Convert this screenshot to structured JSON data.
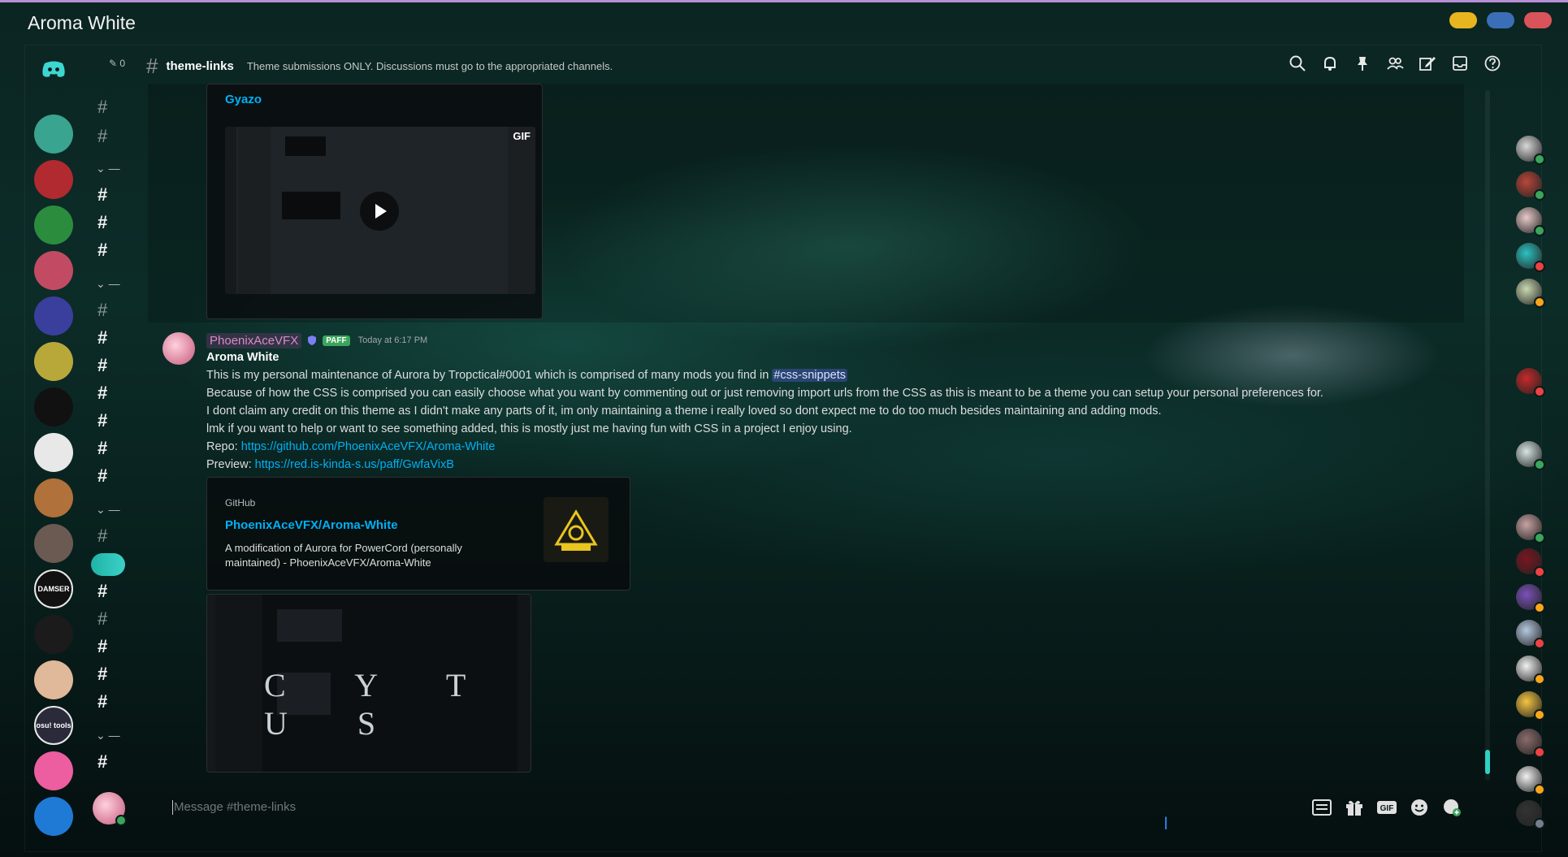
{
  "window": {
    "title": "Aroma White",
    "controls": [
      {
        "name": "minimize",
        "color": "#e6b51f"
      },
      {
        "name": "maximize",
        "color": "#3a6fb8"
      },
      {
        "name": "close",
        "color": "#d9545a"
      }
    ]
  },
  "channel_header": {
    "name": "theme-links",
    "topic": "Theme submissions ONLY. Discussions must go to the appropriated channels.",
    "mention_count": "0",
    "icons": [
      "search-icon",
      "bell-icon",
      "pin-icon",
      "members-icon",
      "edit-icon",
      "inbox-icon",
      "help-icon"
    ]
  },
  "previous_embed": {
    "provider": "Gyazo",
    "media_label": "GIF"
  },
  "message": {
    "author": "PhoenixAceVFX",
    "badge": "PAFF",
    "timestamp": "Today at 6:17 PM",
    "title": "Aroma White",
    "line1_prefix": "This is my personal maintenance of Aurora by Tropctical#0001 which is comprised of many mods you find in ",
    "line1_mention": "#css-snippets",
    "line2": "Because of how the CSS is comprised you can easily choose what you want by commenting out or just removing import urls from the CSS as this is meant to be a theme you can setup your personal preferences for.",
    "line3": "I dont claim any credit on this theme as I didn't make any parts of it, im only maintaining a theme i really loved so dont expect me to do too much besides maintaining and adding mods.",
    "line4": "lmk if you want to help or want to see something added, this is mostly just me having fun with CSS in a project I enjoy using.",
    "repo_label": "Repo: ",
    "repo_url": "https://github.com/PhoenixAceVFX/Aroma-White",
    "preview_label": "Preview: ",
    "preview_url": "https://red.is-kinda-s.us/paff/GwfaVixB"
  },
  "github_embed": {
    "provider": "GitHub",
    "title": "PhoenixAceVFX/Aroma-White",
    "description": "A modification of Aurora for PowerCord (personally maintained) - PhoenixAceVFX/Aroma-White",
    "thumb_text": "BIO HAZARD"
  },
  "screenshot_overlay": "C Y T U S",
  "composer": {
    "placeholder": "Message #theme-links",
    "icons": [
      "list-icon",
      "gift-icon",
      "gif-icon",
      "emoji-icon",
      "sticker-icon"
    ],
    "gif_label": "GIF"
  },
  "servers": [
    {
      "label": "",
      "color": "#39a48f"
    },
    {
      "label": "",
      "color": "#b02a2f"
    },
    {
      "label": "",
      "color": "#2c8c3e"
    },
    {
      "label": "",
      "color": "#c24b63"
    },
    {
      "label": "",
      "color": "#3a3f9e"
    },
    {
      "label": "",
      "color": "#b8a83a"
    },
    {
      "label": "",
      "color": "#111111"
    },
    {
      "label": "",
      "color": "#e8e8e8"
    },
    {
      "label": "",
      "color": "#b0713a"
    },
    {
      "label": "",
      "color": "#6b5a52"
    },
    {
      "label": "DAMSER",
      "color": "#111111"
    },
    {
      "label": "",
      "color": "#1b1b1b"
    },
    {
      "label": "",
      "color": "#e0b89a"
    },
    {
      "label": "osu! tools",
      "color": "#2a2a3a"
    },
    {
      "label": "",
      "color": "#ec5e9f"
    },
    {
      "label": "",
      "color": "#1f7ad6"
    }
  ],
  "members_colors": [
    "#d8d8d8",
    "#b7473a",
    "#e7c9c9",
    "#2cc1c1",
    "#c9d8b0",
    "#c42a2a",
    "#d5e4e2",
    "#c7a2a2",
    "#7a1620",
    "#7a52b8",
    "#b5c8e0",
    "#f1f1f1",
    "#f5c542",
    "#8a6c6c",
    "#f0f0f0",
    "#333333"
  ]
}
